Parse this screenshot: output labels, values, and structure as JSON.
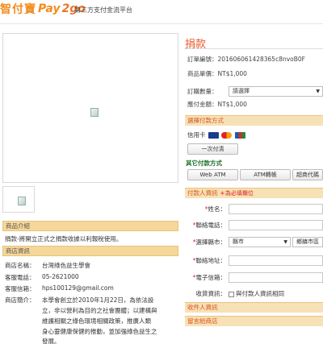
{
  "brand": {
    "logo_cn": "智付寶",
    "logo_en_a": "Pay",
    "logo_en_b": "2go",
    "tagline": "第三方支付金流平台"
  },
  "left": {
    "intro_header": "商品介紹",
    "intro_text": "捐款-將開立正式之捐款收據以利報稅使用。",
    "shop_header": "商店資訊",
    "shop_rows": [
      {
        "label": "商店名稱：",
        "value": "台灣綠色益生學會"
      },
      {
        "label": "客服電話：",
        "value": "05-2621000"
      },
      {
        "label": "客服信箱：",
        "value": "hps100129@gmail.com"
      }
    ],
    "shop_intro_label": "商店簡介：",
    "shop_intro_lines": [
      "本學會創立於2010年1月22日，為依法設",
      "立，非以營利為目的之社會團體；以建構與",
      "維護相關之綠色環境相關政策，推廣人類",
      "身心靈健康保健的推動，並加強綠色益生之",
      "發展。"
    ]
  },
  "right": {
    "title": "捐款",
    "order_no_label": "訂單編號：",
    "order_no": "201606061428365c8nvoB0F",
    "unit_price_label": "商品單價：",
    "unit_price": "NT$1,000",
    "qty_label": "訂購數量：",
    "qty_value": "請選擇",
    "total_label": "應付金額：",
    "total": "NT$1,000",
    "pay_method_header": "選擇付款方式",
    "credit_card_label": "信用卡",
    "btn_one_time": "一次付清",
    "other_methods_label": "其它付款方式",
    "btn_webatm": "Web ATM",
    "btn_atm": "ATM轉帳",
    "btn_cvs": "超商代碼",
    "payer_header": "付款人資訊",
    "payer_hint": "＊為必填欄位",
    "fields": {
      "name": "姓名：",
      "phone": "聯絡電話：",
      "city": "選擇縣市：",
      "city_select": "縣市",
      "district_select": "鄉鎮市區",
      "address": "聯絡地址：",
      "email": "電子信箱：",
      "same_as": "收貨資訊：",
      "same_as_text": "與付款人資訊相同"
    },
    "payer_footer_header": "收件人資訊",
    "notes_header": "留言給商店"
  }
}
